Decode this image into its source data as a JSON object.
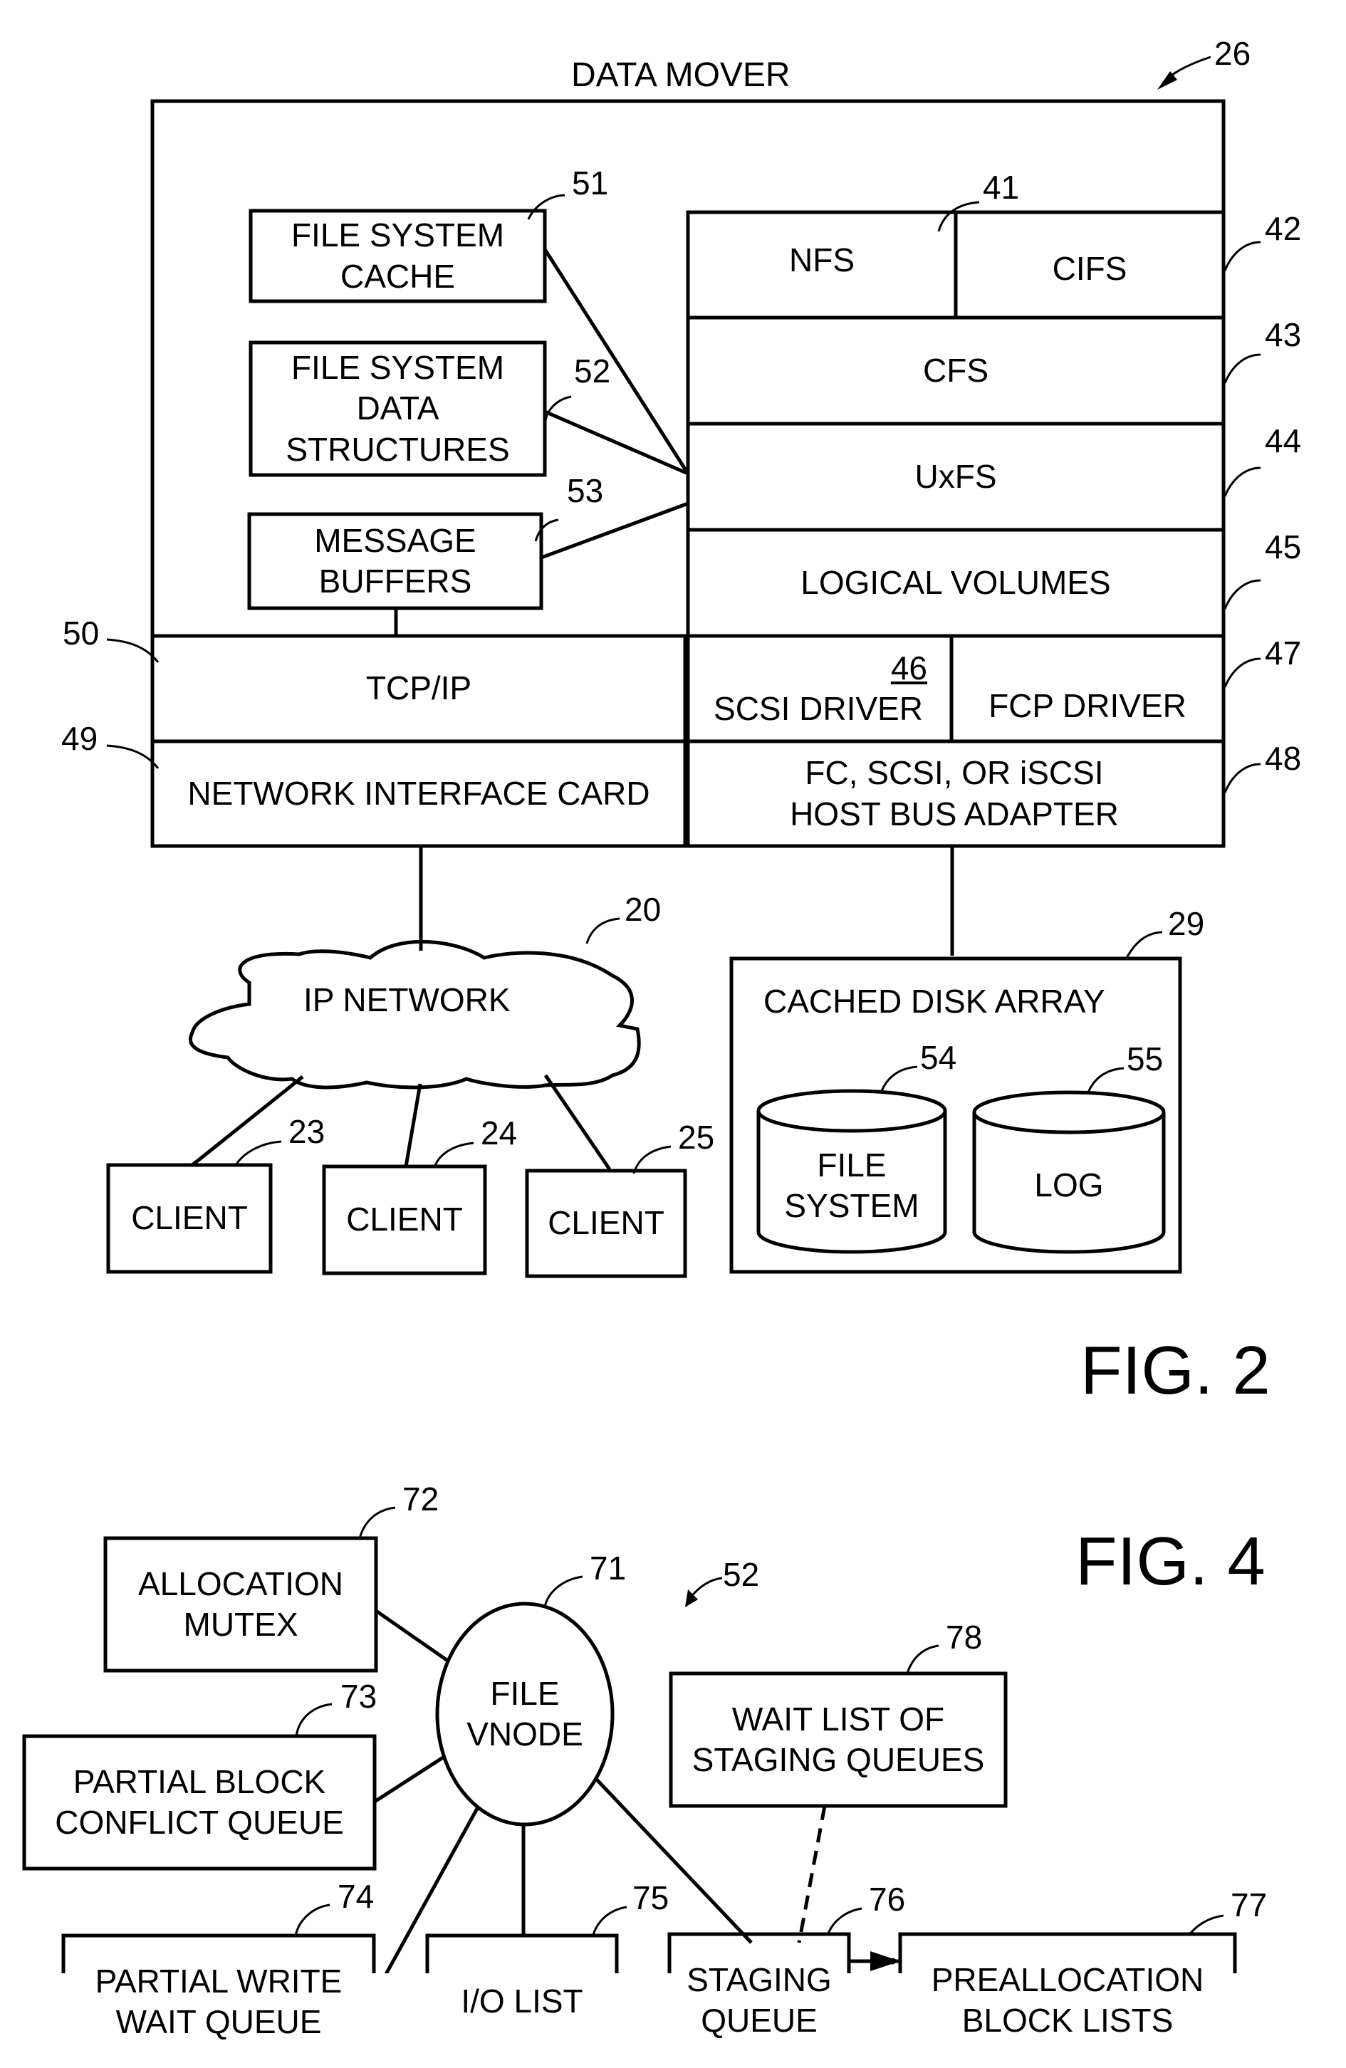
{
  "figure2": {
    "figure_label": "FIG. 2",
    "title": "DATA MOVER",
    "title_ref": "26",
    "layers": {
      "nfs": {
        "label": "NFS",
        "ref": "41"
      },
      "cifs": {
        "label": "CIFS",
        "ref": "42"
      },
      "cfs": {
        "label": "CFS",
        "ref": "43"
      },
      "uxfs": {
        "label": "UxFS",
        "ref": "44"
      },
      "logical_volumes": {
        "label": "LOGICAL VOLUMES",
        "ref": "45"
      },
      "scsi_driver": {
        "label": "SCSI DRIVER",
        "ref": "46"
      },
      "fcp_driver": {
        "label": "FCP DRIVER",
        "ref": "47"
      },
      "hba": {
        "label_line1": "FC, SCSI, OR iSCSI",
        "label_line2": "HOST BUS ADAPTER",
        "ref": "48"
      },
      "nic": {
        "label": "NETWORK INTERFACE CARD",
        "ref": "49"
      },
      "tcpip": {
        "label": "TCP/IP",
        "ref": "50"
      }
    },
    "memory": {
      "fs_cache": {
        "line1": "FILE SYSTEM",
        "line2": "CACHE",
        "ref": "51"
      },
      "fs_data_structures": {
        "line1": "FILE SYSTEM",
        "line2": "DATA",
        "line3": "STRUCTURES",
        "ref": "52"
      },
      "message_buffers": {
        "line1": "MESSAGE",
        "line2": "BUFFERS",
        "ref": "53"
      }
    },
    "network": {
      "label": "IP NETWORK",
      "ref": "20"
    },
    "clients": [
      {
        "label": "CLIENT",
        "ref": "23"
      },
      {
        "label": "CLIENT",
        "ref": "24"
      },
      {
        "label": "CLIENT",
        "ref": "25"
      }
    ],
    "disk_array": {
      "label": "CACHED DISK ARRAY",
      "ref": "29",
      "file_system": {
        "line1": "FILE",
        "line2": "SYSTEM",
        "ref": "54"
      },
      "log": {
        "label": "LOG",
        "ref": "55"
      }
    }
  },
  "figure4": {
    "figure_label": "FIG. 4",
    "group_ref": "52",
    "vnode": {
      "line1": "FILE",
      "line2": "VNODE",
      "ref": "71"
    },
    "allocation_mutex": {
      "line1": "ALLOCATION",
      "line2": "MUTEX",
      "ref": "72"
    },
    "partial_block_conflict_queue": {
      "line1": "PARTIAL BLOCK",
      "line2": "CONFLICT QUEUE",
      "ref": "73"
    },
    "partial_write_wait_queue": {
      "line1": "PARTIAL WRITE",
      "line2": "WAIT QUEUE",
      "ref": "74"
    },
    "io_list": {
      "label": "I/O LIST",
      "ref": "75"
    },
    "staging_queue": {
      "line1": "STAGING",
      "line2": "QUEUE",
      "ref": "76"
    },
    "preallocation_block_lists": {
      "line1": "PREALLOCATION",
      "line2": "BLOCK LISTS",
      "ref": "77"
    },
    "wait_list": {
      "line1": "WAIT LIST OF",
      "line2": "STAGING QUEUES",
      "ref": "78"
    }
  }
}
